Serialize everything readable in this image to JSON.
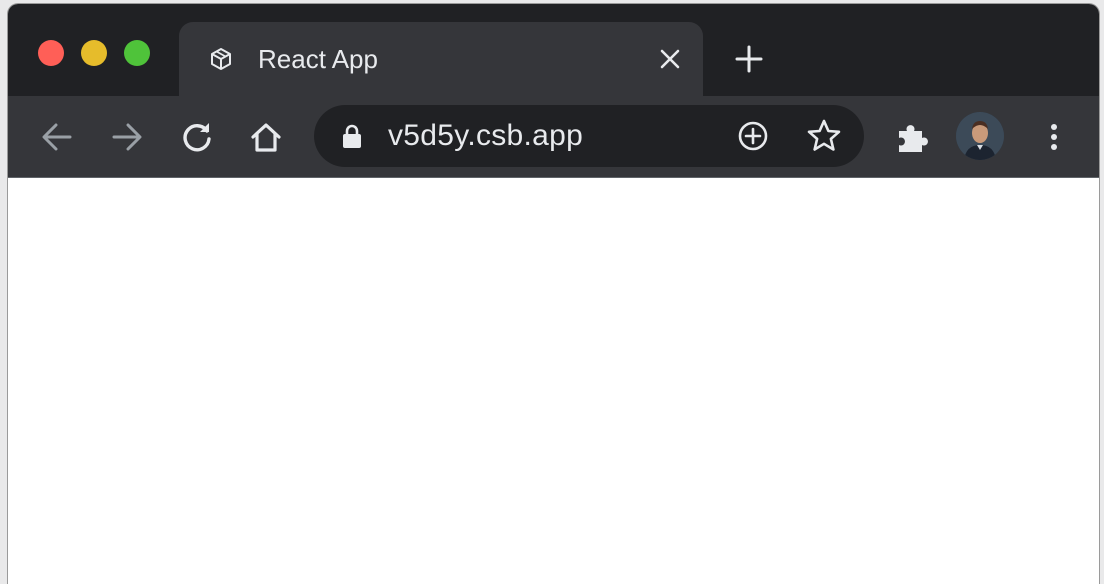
{
  "window": {
    "controls": [
      "close",
      "minimize",
      "maximize"
    ]
  },
  "tab": {
    "title": "React App",
    "favicon": "codesandbox-cube-icon",
    "close_icon": "close-icon"
  },
  "new_tab_icon": "plus-icon",
  "toolbar": {
    "back_icon": "arrow-left-icon",
    "forward_icon": "arrow-right-icon",
    "reload_icon": "reload-icon",
    "home_icon": "home-icon",
    "extensions_icon": "puzzle-icon",
    "menu_icon": "vertical-dots-icon"
  },
  "omnibox": {
    "url": "v5d5y.csb.app",
    "secure_icon": "lock-icon",
    "install_icon": "add-circle-icon",
    "bookmark_icon": "star-icon"
  },
  "colors": {
    "tabstrip": "#202124",
    "toolbar": "#35363a",
    "text": "#e8eaed",
    "close": "#ff5f57",
    "minimize": "#e6bc2b",
    "maximize": "#4fc33a"
  }
}
